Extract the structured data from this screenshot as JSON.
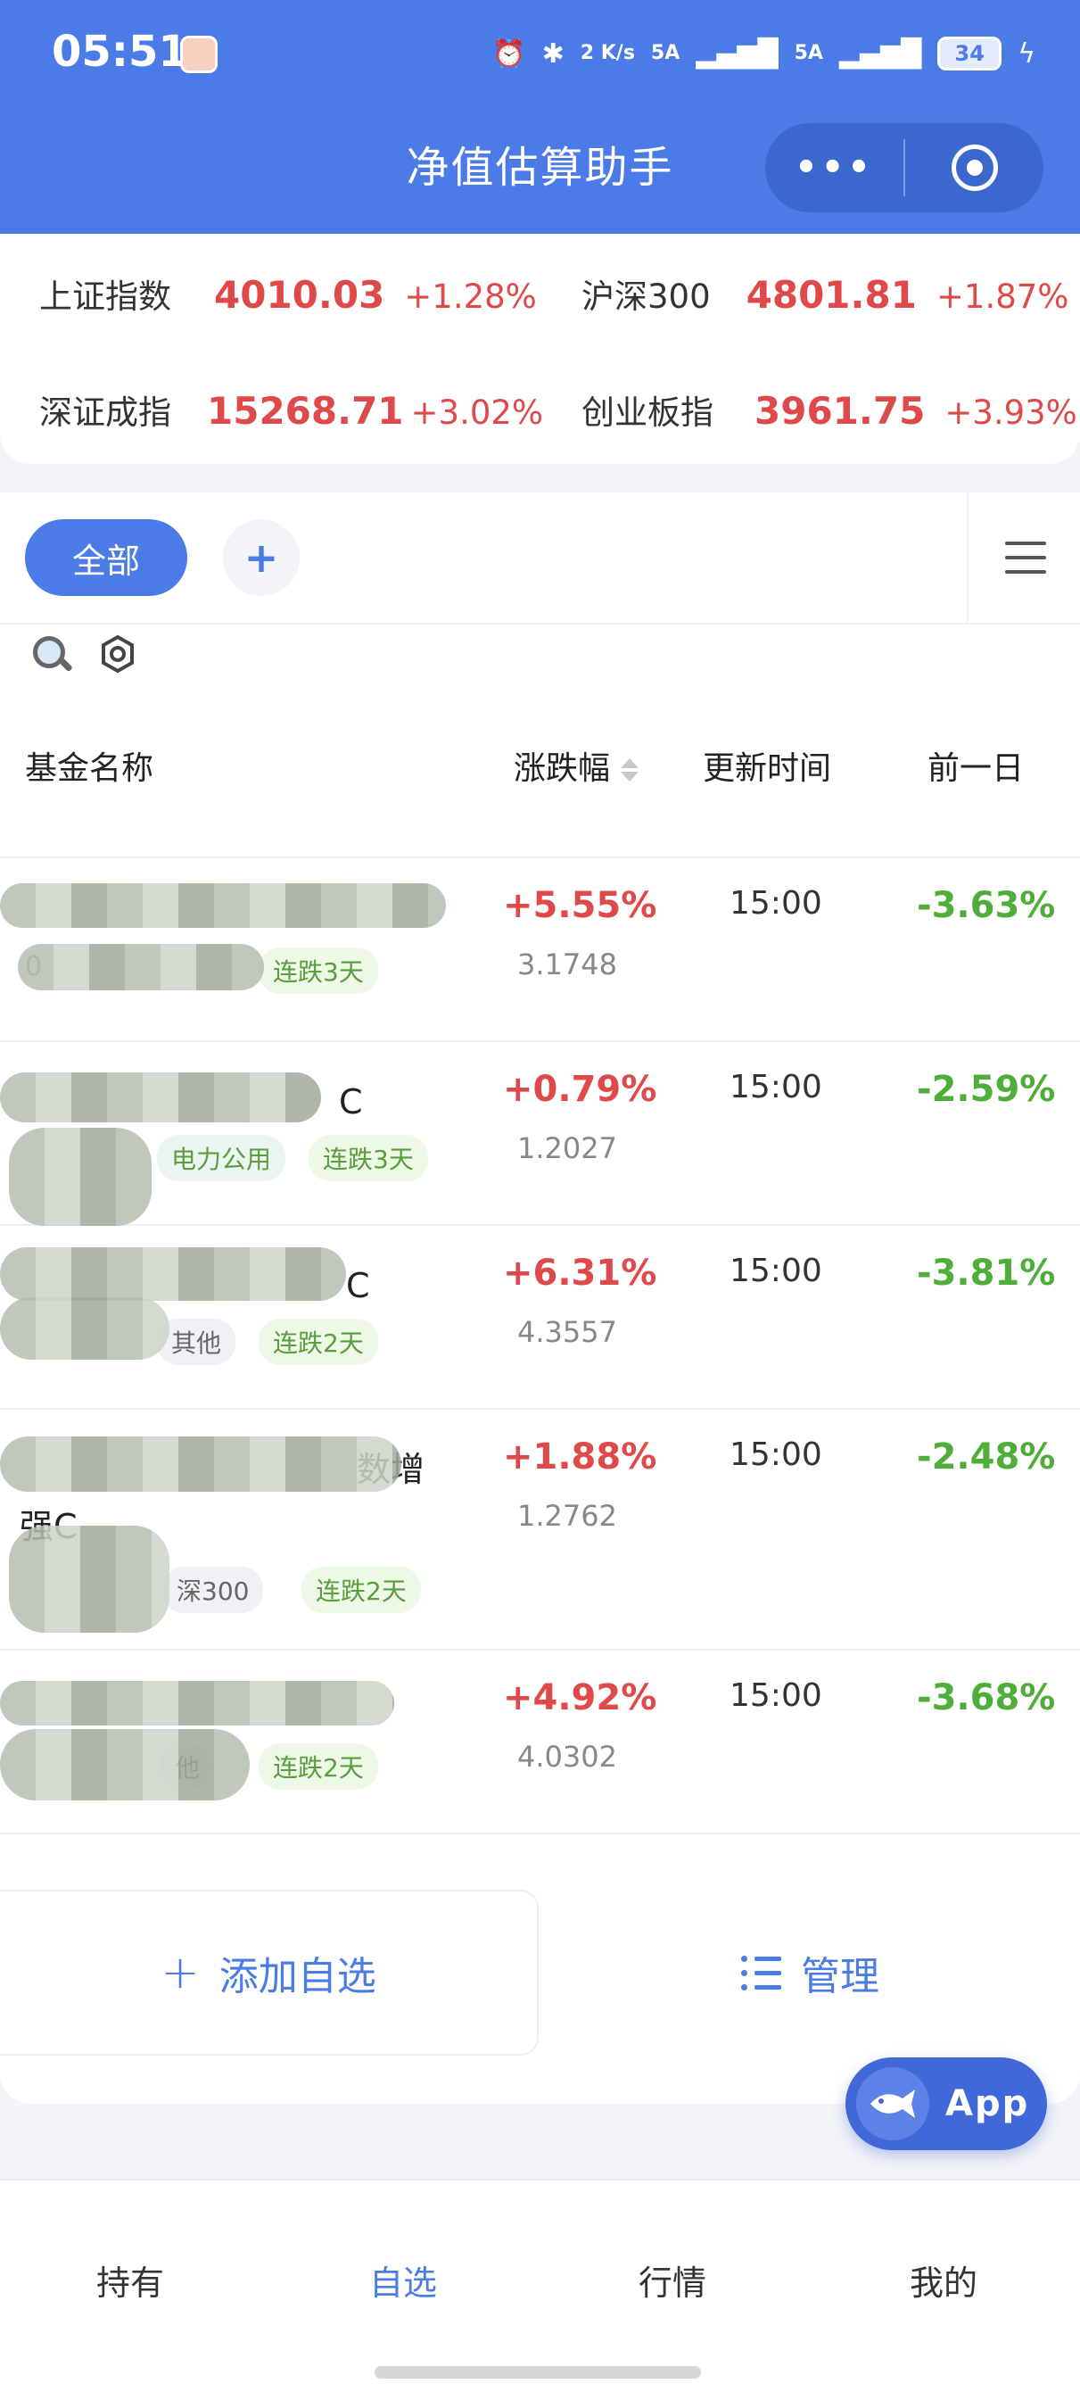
{
  "status_bar": {
    "time": "05:51",
    "network_speed": "2 K/s",
    "signal_1": "5A",
    "signal_2": "5A",
    "battery": "34"
  },
  "header": {
    "title": "净值估算助手",
    "more_icon": "more-dots-icon",
    "close_icon": "target-icon"
  },
  "indices": [
    {
      "name": "上证指数",
      "value": "4010.03",
      "change": "+1.28%"
    },
    {
      "name": "沪深300",
      "value": "4801.81",
      "change": "+1.87%"
    },
    {
      "name": "深证成指",
      "value": "15268.71",
      "change": "+3.02%"
    },
    {
      "name": "创业板指",
      "value": "3961.75",
      "change": "+3.93%"
    }
  ],
  "tabs": {
    "all_label": "全部",
    "add_label": "+"
  },
  "columns": {
    "name": "基金名称",
    "change": "涨跌幅",
    "time": "更新时间",
    "prev": "前一日"
  },
  "funds": [
    {
      "name_fragment": "",
      "code_fragment": "0",
      "tags": [
        "连跌3天"
      ],
      "change": "+5.55%",
      "nav": "3.1748",
      "time": "15:00",
      "prev": "-3.63%"
    },
    {
      "name_fragment": "C",
      "code_fragment": "",
      "tags": [
        "电力公用",
        "连跌3天"
      ],
      "change": "+0.79%",
      "nav": "1.2027",
      "time": "15:00",
      "prev": "-2.59%"
    },
    {
      "name_fragment": "C",
      "code_fragment": "",
      "tags": [
        "其他",
        "连跌2天"
      ],
      "change": "+6.31%",
      "nav": "4.3557",
      "time": "15:00",
      "prev": "-3.81%"
    },
    {
      "name_fragment": "数增",
      "name_line2": "强C",
      "code_fragment": "",
      "tags": [
        "深300",
        "连跌2天"
      ],
      "change": "+1.88%",
      "nav": "1.2762",
      "time": "15:00",
      "prev": "-2.48%"
    },
    {
      "name_fragment": "",
      "code_fragment": "",
      "tags": [
        "他",
        "连跌2天"
      ],
      "change": "+4.92%",
      "nav": "4.0302",
      "time": "15:00",
      "prev": "-3.68%"
    }
  ],
  "actions": {
    "add_label": "添加自选",
    "manage_label": "管理"
  },
  "app_button": {
    "label": "App"
  },
  "tabbar": [
    {
      "label": "持有",
      "active": false
    },
    {
      "label": "自选",
      "active": true
    },
    {
      "label": "行情",
      "active": false
    },
    {
      "label": "我的",
      "active": false
    }
  ],
  "colors": {
    "primary": "#4b7be6",
    "up": "#e04949",
    "down": "#4fae3a"
  }
}
